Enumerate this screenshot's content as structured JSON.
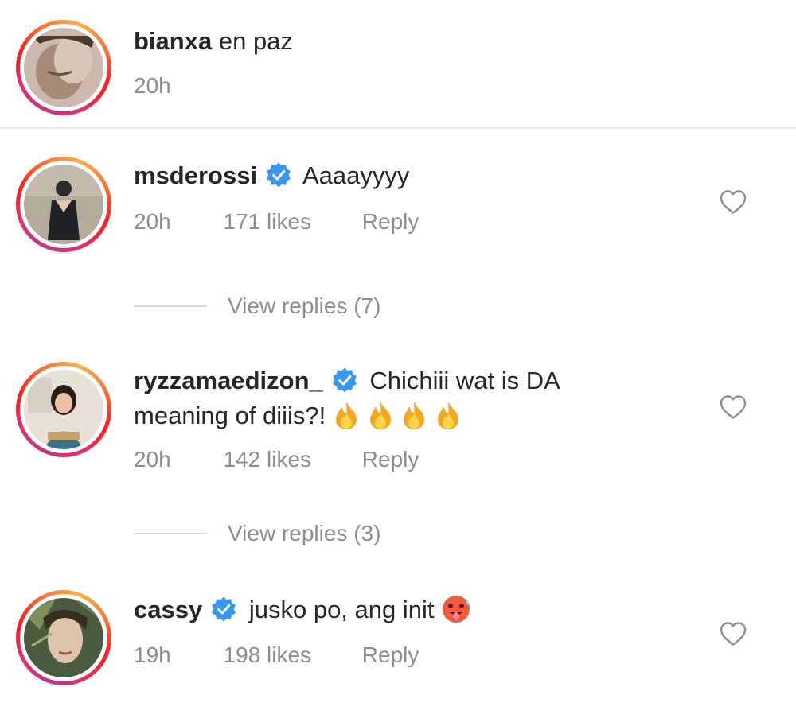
{
  "caption": {
    "username": "bianxa",
    "text": "en paz",
    "time": "20h"
  },
  "comments": [
    {
      "username": "msderossi",
      "verified": true,
      "text": "Aaaayyyy",
      "time": "20h",
      "likes": "171 likes",
      "reply": "Reply",
      "view_replies": "View replies (7)"
    },
    {
      "username": "ryzzamaedizon_",
      "verified": true,
      "text_line1": "Chichiii wat is DA",
      "text_line2": "meaning of diiis?!",
      "emoji": [
        "fire-emoji",
        "fire-emoji",
        "fire-emoji",
        "fire-emoji"
      ],
      "time": "20h",
      "likes": "142 likes",
      "reply": "Reply",
      "view_replies": "View replies (3)"
    },
    {
      "username": "cassy",
      "verified": true,
      "text": "jusko po, ang init",
      "emoji": [
        "hot-face-emoji"
      ],
      "time": "19h",
      "likes": "198 likes",
      "reply": "Reply"
    }
  ],
  "colors": {
    "text": "#262626",
    "secondary": "#8e8e8e",
    "verified": "#3897f0",
    "ring_start": "#c13584",
    "ring_end": "#fcaf45"
  }
}
